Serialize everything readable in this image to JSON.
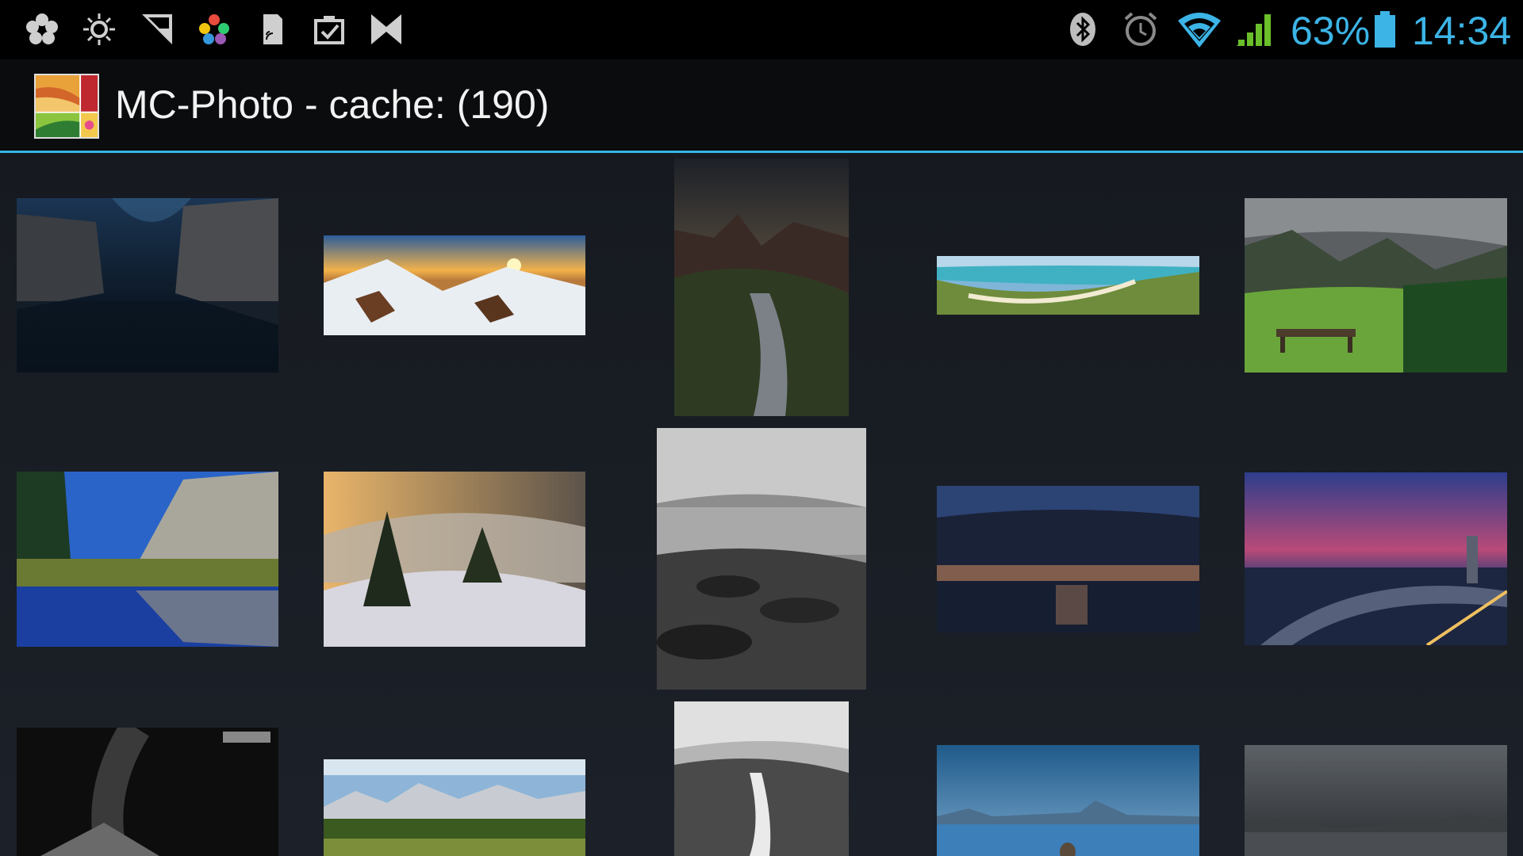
{
  "status_bar": {
    "notification_icons": [
      "flower-icon",
      "sun-icon",
      "corner-signal-icon",
      "color-dots-icon",
      "sd-card-icon",
      "clipboard-check-icon",
      "bowtie-icon"
    ],
    "system_icons": [
      "bluetooth-icon",
      "alarm-icon",
      "wifi-icon",
      "cell-signal-icon",
      "battery-icon"
    ],
    "battery_percent": "63%",
    "time": "14:34",
    "accent_color": "#3cb4e6"
  },
  "action_bar": {
    "title": "MC-Photo - cache: (190)",
    "divider_color": "#33b5e5"
  },
  "gallery": {
    "photos": [
      {
        "subject": "night canyon with milky way"
      },
      {
        "subject": "snowy mountain sunset panorama"
      },
      {
        "subject": "starry valley with stream"
      },
      {
        "subject": "turquoise bay beach panorama"
      },
      {
        "subject": "green alpine meadow with bench"
      },
      {
        "subject": "mountain lake reflection"
      },
      {
        "subject": "foggy snowy forest"
      },
      {
        "subject": "black and white rocky coast"
      },
      {
        "subject": "dark clouds over lake at dusk"
      },
      {
        "subject": "city river at twilight"
      },
      {
        "subject": "black and white architecture long exposure"
      },
      {
        "subject": "mountain range with forest"
      },
      {
        "subject": "black and white rocks and waves"
      },
      {
        "subject": "blue lake with volcanoes"
      },
      {
        "subject": "grey cloudy lake"
      }
    ]
  }
}
